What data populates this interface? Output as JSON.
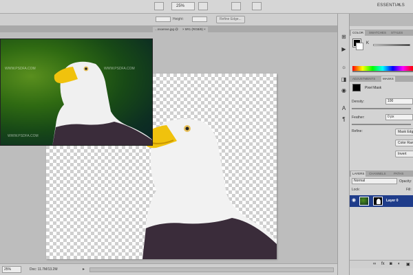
{
  "app": {
    "workspace": "ESSENTIALS"
  },
  "menubar": {
    "zoom": "25%"
  },
  "options_bar": {
    "height_label": "Height:",
    "refine_edge_label": "Refine Edge..."
  },
  "tabs": [
    {
      "label": "...nsoenve.jpg @"
    },
    {
      "label": "× 5R1 (RGB/8) ×"
    }
  ],
  "watermarks": [
    "WWW.PSDFA.COM",
    "WWW.PSDFA.COM",
    "WWW.PSDFA.COM"
  ],
  "status_bar": {
    "zoom": "25%",
    "doc_info": "Doc: 11.7M/13.2M"
  },
  "panels": {
    "color_tabs": [
      "COLOR",
      "SWATCHES",
      "STYLES"
    ],
    "color_k_label": "K",
    "masks_tabs": [
      "ADJUSTMENTS",
      "MASKS"
    ],
    "mask_label": "Pixel Mask",
    "density_label": "Density:",
    "density_value": "100",
    "feather_label": "Feather:",
    "feather_value": "0 px",
    "refine_label": "Refine:",
    "buttons": [
      "Mask Edge...",
      "Color Range...",
      "Invert"
    ],
    "layers_tabs": [
      "LAYERS",
      "CHANNELS",
      "PATHS"
    ],
    "blend_mode": "Normal",
    "opacity_label": "Opacity:",
    "lock_label": "Lock:",
    "fill_label": "Fill:",
    "layer_name": "Layer 0"
  }
}
